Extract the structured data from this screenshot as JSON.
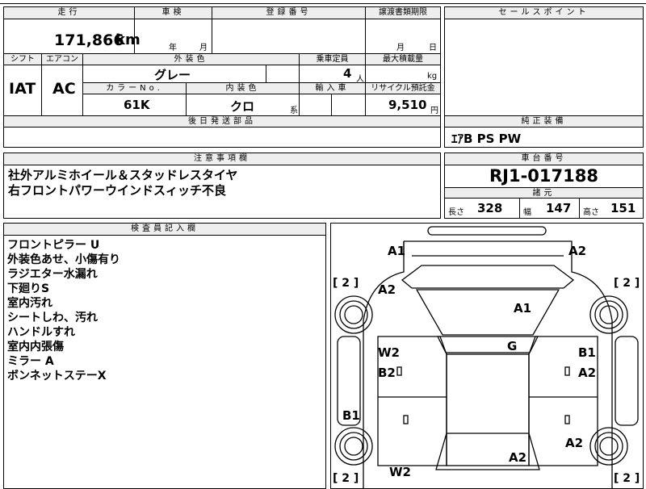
{
  "mileage": {
    "header": "走行",
    "value": "171,866",
    "unit": "km"
  },
  "inspection": {
    "header": "車検",
    "year_unit": "年",
    "month_unit": "月"
  },
  "registration": {
    "header": "登録番号"
  },
  "transfer_deadline": {
    "header": "譲渡書類期限",
    "month_unit": "月",
    "day_unit": "日"
  },
  "sales_point": {
    "header": "セールスポイント"
  },
  "shift": {
    "header": "シフト",
    "value": "IAT"
  },
  "aircon": {
    "header": "エアコン",
    "value": "AC"
  },
  "exterior_color": {
    "header": "外装色",
    "value": "グレー"
  },
  "capacity": {
    "header": "乗車定員",
    "value": "4",
    "unit": "人"
  },
  "max_load": {
    "header": "最大積載量",
    "unit": "kg"
  },
  "color_no": {
    "header": "カラーNo.",
    "value": "61K"
  },
  "interior_color": {
    "header": "内装色",
    "value": "クロ",
    "suffix": "系"
  },
  "import": {
    "header": "輸入車"
  },
  "recycle": {
    "header": "リサイクル預託金",
    "value": "9,510",
    "unit": "円"
  },
  "later_parts": {
    "header": "後日発送部品"
  },
  "genuine_equipment": {
    "header": "純正装備",
    "value": "ｴｱB PS PW"
  },
  "notes": {
    "header": "注意事項欄",
    "lines": [
      "社外アルミホイール＆スタッドレスタイヤ",
      "右フロントパワーウインドスィッチ不良"
    ]
  },
  "chassis": {
    "header": "車台番号",
    "value": "RJ1-017188"
  },
  "specs": {
    "header": "諸元",
    "length_label": "長さ",
    "length": "328",
    "width_label": "幅",
    "width": "147",
    "height_label": "高さ",
    "height": "151"
  },
  "inspector": {
    "header": "検査員記入欄",
    "lines": [
      "フロントピラー U",
      "外装色あせ、小傷有り",
      "ラジエター水漏れ",
      "下廻りS",
      "室内汚れ",
      "シートしわ、汚れ",
      "ハンドルすれ",
      "室内内張傷",
      "ミラー A",
      "ボンネットステーX"
    ]
  },
  "diagram": {
    "marks": {
      "tl": "A1",
      "tr": "A2",
      "a2l": "A2",
      "a1c": "A1",
      "g": "G",
      "w2l": "W2",
      "b2l": "B2",
      "b1r": "B1",
      "a2r": "A2",
      "b1l": "B1",
      "a2rr": "A2",
      "a2c": "A2",
      "w2b": "W2"
    },
    "tires": {
      "fl": "[ 2 ]",
      "fr": "[ 2 ]",
      "rl": "[ 2 ]",
      "rr": "[ 2 ]"
    }
  }
}
